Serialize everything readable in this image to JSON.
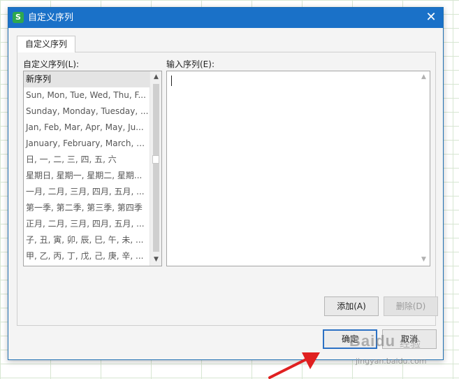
{
  "dialog": {
    "title": "自定义序列",
    "close_glyph": "✕",
    "tab_label": "自定义序列",
    "list_label": "自定义序列(L):",
    "input_label": "输入序列(E):",
    "list_items": [
      "新序列",
      "Sun, Mon, Tue, Wed, Thu, F...",
      "Sunday, Monday, Tuesday, ...",
      "Jan, Feb, Mar, Apr, May, Ju...",
      "January, February, March, A...",
      "日, 一, 二, 三, 四, 五, 六",
      "星期日, 星期一, 星期二, 星期...",
      "一月, 二月, 三月, 四月, 五月, ...",
      "第一季, 第二季, 第三季, 第四季",
      "正月, 二月, 三月, 四月, 五月, ...",
      "子, 丑, 寅, 卯, 辰, 巳, 午, 未, ...",
      "甲, 乙, 丙, 丁, 戊, 己, 庚, 辛, ..."
    ],
    "selected_index": 0,
    "input_value": "",
    "add_label": "添加(A)",
    "delete_label": "删除(D)",
    "ok_label": "确定",
    "cancel_label": "取消"
  },
  "watermark": {
    "logo": "Baidu",
    "text": "经验",
    "url": "jingyan.baidu.com"
  },
  "colors": {
    "titlebar": "#1a71c8",
    "primary_border": "#2c71c4",
    "annotation_arrow": "#e02020",
    "grid": "#d7e6d2"
  },
  "icons": {
    "app": "wps-spreadsheet-icon",
    "close": "close-icon",
    "scroll_up": "chevron-up-icon",
    "scroll_down": "chevron-down-icon"
  }
}
